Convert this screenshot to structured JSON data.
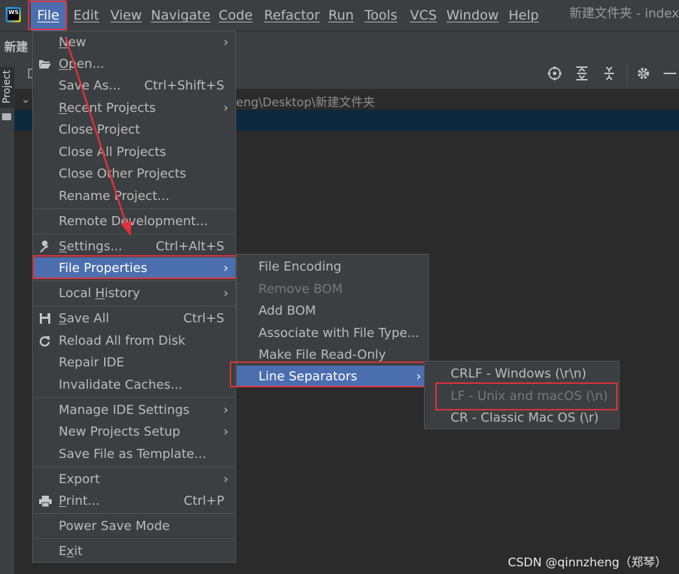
{
  "menubar": {
    "items": [
      "File",
      "Edit",
      "View",
      "Navigate",
      "Code",
      "Refactor",
      "Run",
      "Tools",
      "VCS",
      "Window",
      "Help"
    ],
    "window_title": "新建文件夹 - index",
    "logo_text": "WS"
  },
  "navbar": {
    "project": "新建"
  },
  "tool_window": {
    "tab_label": "Project",
    "path": "eng\\Desktop\\新建文件夹"
  },
  "file_menu": {
    "items": [
      {
        "label": "New",
        "submenu": true
      },
      {
        "label": "Open...",
        "icon": "folder-open-icon"
      },
      {
        "label": "Save As...",
        "shortcut": "Ctrl+Shift+S"
      },
      {
        "label": "Recent Projects",
        "submenu": true
      },
      {
        "label": "Close Project"
      },
      {
        "label": "Close All Projects"
      },
      {
        "label": "Close Other Projects"
      },
      {
        "label": "Rename Project..."
      },
      {
        "label": "Remote Development..."
      },
      {
        "label": "Settings...",
        "shortcut": "Ctrl+Alt+S",
        "icon": "wrench-icon"
      },
      {
        "label": "File Properties",
        "submenu": true
      },
      {
        "label": "Local History",
        "submenu": true
      },
      {
        "label": "Save All",
        "shortcut": "Ctrl+S",
        "icon": "floppy-icon"
      },
      {
        "label": "Reload All from Disk",
        "icon": "reload-icon"
      },
      {
        "label": "Repair IDE"
      },
      {
        "label": "Invalidate Caches..."
      },
      {
        "label": "Manage IDE Settings",
        "submenu": true
      },
      {
        "label": "New Projects Setup",
        "submenu": true
      },
      {
        "label": "Save File as Template..."
      },
      {
        "label": "Export",
        "submenu": true
      },
      {
        "label": "Print...",
        "shortcut": "Ctrl+P",
        "icon": "printer-icon"
      },
      {
        "label": "Power Save Mode"
      },
      {
        "label": "Exit"
      }
    ]
  },
  "file_properties_menu": {
    "items": [
      {
        "label": "File Encoding"
      },
      {
        "label": "Remove BOM",
        "disabled": true
      },
      {
        "label": "Add BOM"
      },
      {
        "label": "Associate with File Type..."
      },
      {
        "label": "Make File Read-Only"
      },
      {
        "label": "Line Separators",
        "submenu": true
      }
    ]
  },
  "line_separators_menu": {
    "items": [
      {
        "label": "CRLF - Windows (\\r\\n)"
      },
      {
        "label": "LF - Unix and macOS (\\n)",
        "disabled": true
      },
      {
        "label": "CR - Classic Mac OS (\\r)"
      }
    ]
  },
  "watermark": "CSDN @qinnzheng（郑琴）",
  "colors": {
    "menu_bg": "#3c3f41",
    "selection": "#4b6eaf",
    "highlight_box": "#e0333a",
    "arrow": "#e0333a"
  }
}
